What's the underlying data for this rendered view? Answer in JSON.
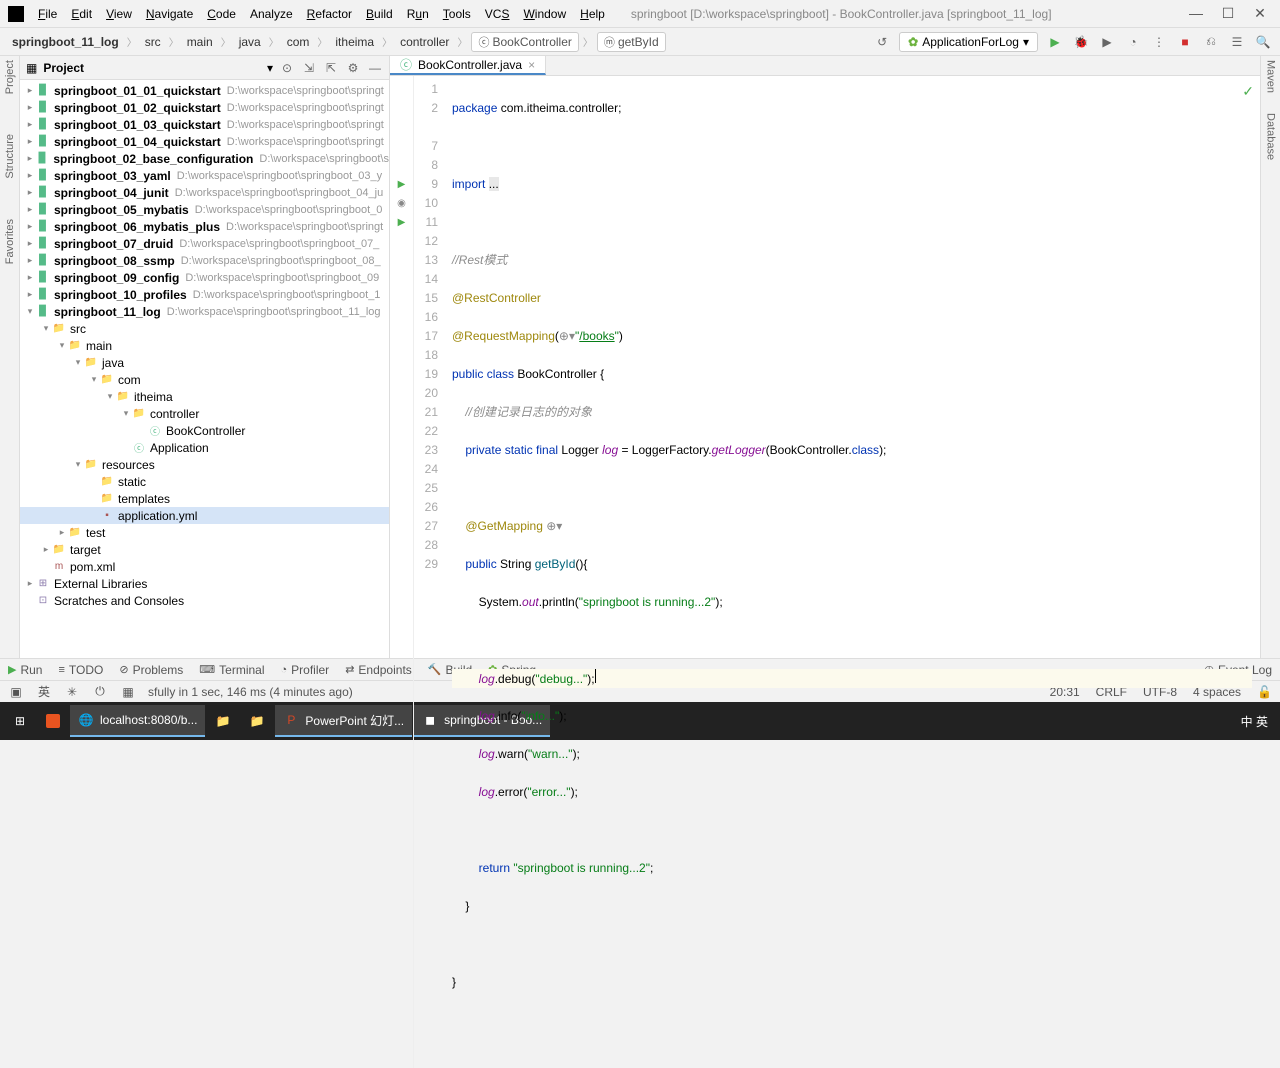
{
  "window": {
    "title": "springboot [D:\\workspace\\springboot] - BookController.java [springboot_11_log]"
  },
  "menu": {
    "file": "File",
    "edit": "Edit",
    "view": "View",
    "navigate": "Navigate",
    "code": "Code",
    "analyze": "Analyze",
    "refactor": "Refactor",
    "build": "Build",
    "run": "Run",
    "tools": "Tools",
    "vcs": "VCS",
    "window": "Window",
    "help": "Help"
  },
  "breadcrumb": {
    "project": "springboot_11_log",
    "parts": [
      "src",
      "main",
      "java",
      "com",
      "itheima",
      "controller"
    ],
    "class": "BookController",
    "method": "getById"
  },
  "run_config": "ApplicationForLog",
  "project_panel": {
    "title": "Project"
  },
  "tree": {
    "modules": [
      {
        "name": "springboot_01_01_quickstart",
        "path": "D:\\workspace\\springboot\\springt"
      },
      {
        "name": "springboot_01_02_quickstart",
        "path": "D:\\workspace\\springboot\\springt"
      },
      {
        "name": "springboot_01_03_quickstart",
        "path": "D:\\workspace\\springboot\\springt"
      },
      {
        "name": "springboot_01_04_quickstart",
        "path": "D:\\workspace\\springboot\\springt"
      },
      {
        "name": "springboot_02_base_configuration",
        "path": "D:\\workspace\\springboot\\s"
      },
      {
        "name": "springboot_03_yaml",
        "path": "D:\\workspace\\springboot\\springboot_03_y"
      },
      {
        "name": "springboot_04_junit",
        "path": "D:\\workspace\\springboot\\springboot_04_ju"
      },
      {
        "name": "springboot_05_mybatis",
        "path": "D:\\workspace\\springboot\\springboot_0"
      },
      {
        "name": "springboot_06_mybatis_plus",
        "path": "D:\\workspace\\springboot\\springt"
      },
      {
        "name": "springboot_07_druid",
        "path": "D:\\workspace\\springboot\\springboot_07_"
      },
      {
        "name": "springboot_08_ssmp",
        "path": "D:\\workspace\\springboot\\springboot_08_"
      },
      {
        "name": "springboot_09_config",
        "path": "D:\\workspace\\springboot\\springboot_09"
      },
      {
        "name": "springboot_10_profiles",
        "path": "D:\\workspace\\springboot\\springboot_1"
      },
      {
        "name": "springboot_11_log",
        "path": "D:\\workspace\\springboot\\springboot_11_log"
      }
    ],
    "expanded": {
      "src": "src",
      "main": "main",
      "java": "java",
      "com": "com",
      "itheima": "itheima",
      "controller": "controller",
      "bookcontroller": "BookController",
      "application": "Application",
      "resources": "resources",
      "static": "static",
      "templates": "templates",
      "appyml": "application.yml",
      "test": "test",
      "target": "target",
      "pom": "pom.xml",
      "extlib": "External Libraries",
      "scratches": "Scratches and Consoles"
    }
  },
  "editor": {
    "tab": "BookController.java",
    "line_numbers": [
      "1",
      "2",
      "",
      "7",
      "8",
      "9",
      "10",
      "11",
      "12",
      "13",
      "14",
      "15",
      "16",
      "17",
      "18",
      "19",
      "20",
      "21",
      "22",
      "23",
      "24",
      "25",
      "26",
      "27",
      "28",
      "29"
    ]
  },
  "bottom_tools": {
    "run": "Run",
    "todo": "TODO",
    "problems": "Problems",
    "terminal": "Terminal",
    "profiler": "Profiler",
    "endpoints": "Endpoints",
    "build": "Build",
    "spring": "Spring",
    "eventlog": "Event Log"
  },
  "status": {
    "msg": "sfully in 1 sec, 146 ms (4 minutes ago)",
    "pos": "20:31",
    "eol": "CRLF",
    "enc": "UTF-8",
    "indent": "4 spaces",
    "ime": "英",
    "tray_ime": "中 英"
  },
  "taskbar": {
    "chrome": "localhost:8080/b...",
    "ppt": "PowerPoint 幻灯...",
    "idea": "springboot - Boo..."
  }
}
